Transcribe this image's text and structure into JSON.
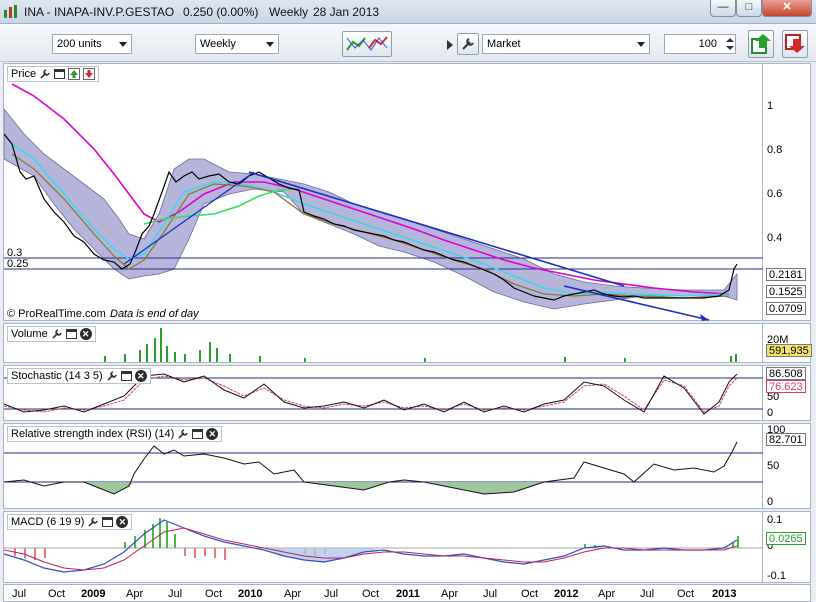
{
  "window": {
    "symbol": "INA - INAPA-INV.P.GESTAO",
    "last": "0.250 (0.00%)",
    "period": "Weekly",
    "date": "28 Jan 2013"
  },
  "toolbar": {
    "units": "200 units",
    "timeframe": "Weekly",
    "order_type": "Market",
    "quantity": "100"
  },
  "price_panel": {
    "title": "Price",
    "axis_ticks": [
      "1",
      "0.8",
      "0.6",
      "0.4"
    ],
    "hline_labels": [
      "0.3",
      "0.25"
    ],
    "value_boxes": [
      "0.2181",
      "0.1525",
      "0.0709"
    ],
    "watermark": "© ProRealTime.com",
    "note": "Data is end of day"
  },
  "volume_panel": {
    "title": "Volume",
    "axis_label": "20M",
    "value": "591,935"
  },
  "stochastic_panel": {
    "title": "Stochastic (14 3 5)",
    "value_main": "86.508",
    "value_signal": "76.623",
    "axis_ticks": [
      "50",
      "0"
    ]
  },
  "rsi_panel": {
    "title": "Relative strength index (RSI) (14)",
    "value": "82.701",
    "axis_ticks": [
      "100",
      "50",
      "0"
    ]
  },
  "macd_panel": {
    "title": "MACD (6 19 9)",
    "value": "0.0265",
    "axis_ticks": [
      "0.1",
      "0",
      "-0.1"
    ]
  },
  "xaxis": [
    {
      "label": "Jul",
      "bold": false
    },
    {
      "label": "Oct",
      "bold": false
    },
    {
      "label": "2009",
      "bold": true
    },
    {
      "label": "Apr",
      "bold": false
    },
    {
      "label": "Jul",
      "bold": false
    },
    {
      "label": "Oct",
      "bold": false
    },
    {
      "label": "2010",
      "bold": true
    },
    {
      "label": "Apr",
      "bold": false
    },
    {
      "label": "Jul",
      "bold": false
    },
    {
      "label": "Oct",
      "bold": false
    },
    {
      "label": "2011",
      "bold": true
    },
    {
      "label": "Apr",
      "bold": false
    },
    {
      "label": "Jul",
      "bold": false
    },
    {
      "label": "Oct",
      "bold": false
    },
    {
      "label": "2012",
      "bold": true
    },
    {
      "label": "Apr",
      "bold": false
    },
    {
      "label": "Jul",
      "bold": false
    },
    {
      "label": "Oct",
      "bold": false
    },
    {
      "label": "2013",
      "bold": true
    }
  ],
  "colors": {
    "bollinger_fill": "#b6b6dc",
    "ma_magenta": "#e000d0",
    "ma_cyan": "#40d8e8",
    "ma_olive": "#8a7a30",
    "ma_green": "#30e060",
    "trendline": "#1a2fc8",
    "hline": "#2a2a8a"
  }
}
